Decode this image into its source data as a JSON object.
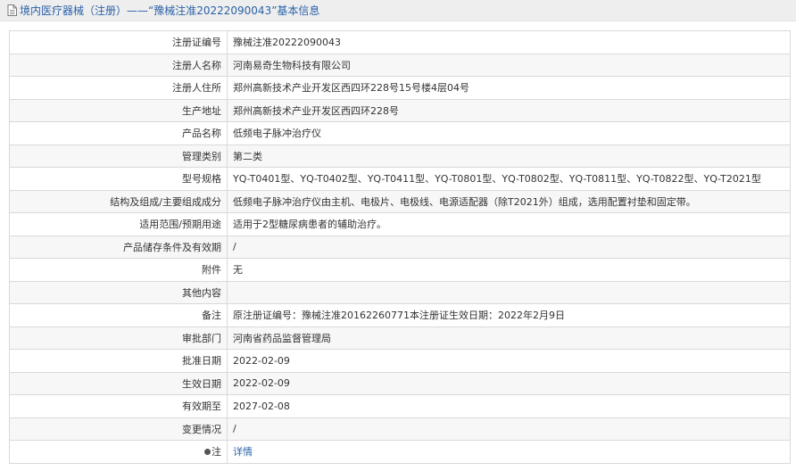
{
  "header": {
    "title": "境内医疗器械（注册）——“豫械注准20222090043”基本信息"
  },
  "rows": [
    {
      "label": "注册证编号",
      "value": "豫械注准20222090043"
    },
    {
      "label": "注册人名称",
      "value": "河南易奇生物科技有限公司"
    },
    {
      "label": "注册人住所",
      "value": "郑州高新技术产业开发区西四环228号15号楼4层04号"
    },
    {
      "label": "生产地址",
      "value": "郑州高新技术产业开发区西四环228号"
    },
    {
      "label": "产品名称",
      "value": "低频电子脉冲治疗仪"
    },
    {
      "label": "管理类别",
      "value": "第二类"
    },
    {
      "label": "型号规格",
      "value": "YQ-T0401型、YQ-T0402型、YQ-T0411型、YQ-T0801型、YQ-T0802型、YQ-T0811型、YQ-T0822型、YQ-T2021型"
    },
    {
      "label": "结构及组成/主要组成成分",
      "value": "低频电子脉冲治疗仪由主机、电极片、电极线、电源适配器（除T2021外）组成，选用配置衬垫和固定带。"
    },
    {
      "label": "适用范围/预期用途",
      "value": "适用于2型糖尿病患者的辅助治疗。"
    },
    {
      "label": "产品储存条件及有效期",
      "value": "/"
    },
    {
      "label": "附件",
      "value": "无"
    },
    {
      "label": "其他内容",
      "value": ""
    },
    {
      "label": "备注",
      "value": "原注册证编号：豫械注准20162260771本注册证生效日期：2022年2月9日"
    },
    {
      "label": "审批部门",
      "value": "河南省药品监督管理局"
    },
    {
      "label": "批准日期",
      "value": "2022-02-09"
    },
    {
      "label": "生效日期",
      "value": "2022-02-09"
    },
    {
      "label": "有效期至",
      "value": "2027-02-08"
    },
    {
      "label": "变更情况",
      "value": "/"
    }
  ],
  "note_row": {
    "label": "注",
    "link_text": "详情",
    "icon": "dot-icon"
  }
}
